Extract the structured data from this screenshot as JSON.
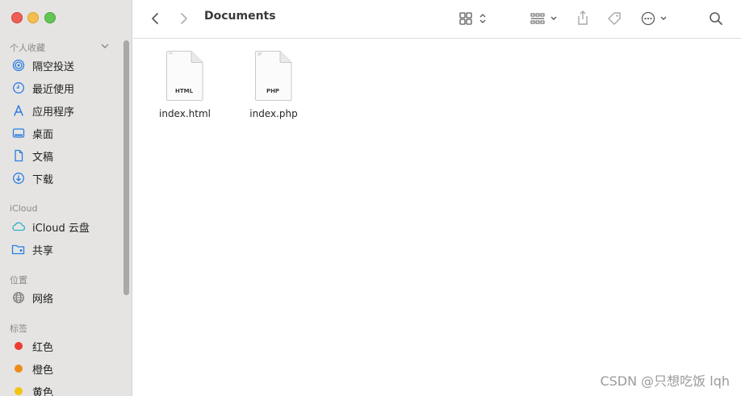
{
  "window": {
    "title": "Documents"
  },
  "sidebar": {
    "sections": [
      {
        "header": "个人收藏",
        "items": [
          {
            "label": "隔空投送",
            "icon": "airdrop-icon"
          },
          {
            "label": "最近使用",
            "icon": "clock-icon"
          },
          {
            "label": "应用程序",
            "icon": "applications-icon"
          },
          {
            "label": "桌面",
            "icon": "desktop-icon"
          },
          {
            "label": "文稿",
            "icon": "document-icon"
          },
          {
            "label": "下载",
            "icon": "download-icon"
          }
        ]
      },
      {
        "header": "iCloud",
        "items": [
          {
            "label": "iCloud 云盘",
            "icon": "cloud-icon"
          },
          {
            "label": "共享",
            "icon": "shared-folder-icon"
          }
        ]
      },
      {
        "header": "位置",
        "items": [
          {
            "label": "网络",
            "icon": "network-globe-icon"
          }
        ]
      },
      {
        "header": "标签",
        "items": [
          {
            "label": "红色",
            "color": "#ee3b30"
          },
          {
            "label": "橙色",
            "color": "#f08a1c"
          },
          {
            "label": "黄色",
            "color": "#f2c40f"
          }
        ]
      }
    ]
  },
  "files": [
    {
      "name": "index.html",
      "type": "HTML"
    },
    {
      "name": "index.php",
      "type": "PHP"
    }
  ],
  "watermark": "CSDN @只想吃饭 lqh",
  "colors": {
    "accent": "#2b7de0",
    "sidebar_bg": "#e5e4e3"
  }
}
